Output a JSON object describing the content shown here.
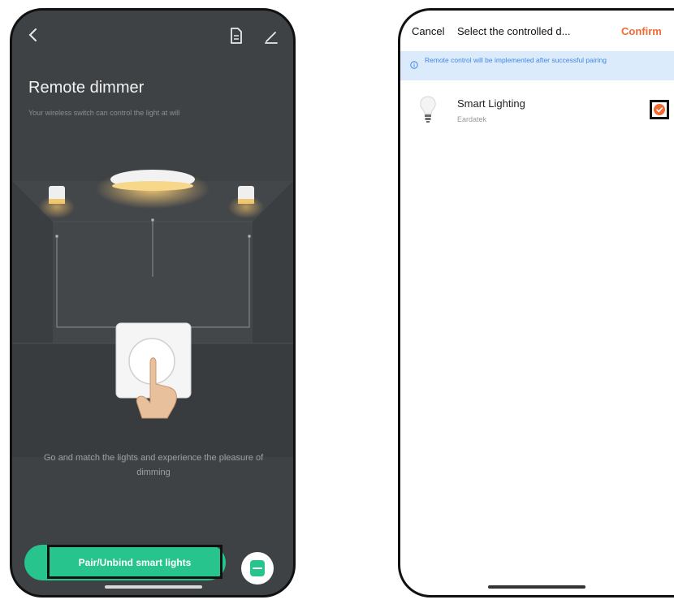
{
  "left_screen": {
    "title": "Remote dimmer",
    "subtitle": "Your wireless switch can control the light at will",
    "description": "Go and match the lights and experience the pleasure of dimming",
    "pair_button_label": "Pair/Unbind smart lights",
    "icons": [
      "back-chevron-icon",
      "document-icon",
      "edit-icon",
      "switch-icon"
    ],
    "colors": {
      "background": "#3f4245",
      "accent": "#27c58d"
    }
  },
  "right_screen": {
    "header": {
      "cancel_label": "Cancel",
      "title": "Select the controlled d...",
      "confirm_label": "Confirm"
    },
    "banner_text": "Remote control will be implemented after successful pairing",
    "devices": [
      {
        "name": "Smart Lighting",
        "brand": "Eardatek",
        "selected": true
      }
    ],
    "colors": {
      "banner_background": "#dcebfb",
      "banner_text": "#3f86e6",
      "accent": "#f06b34"
    }
  }
}
